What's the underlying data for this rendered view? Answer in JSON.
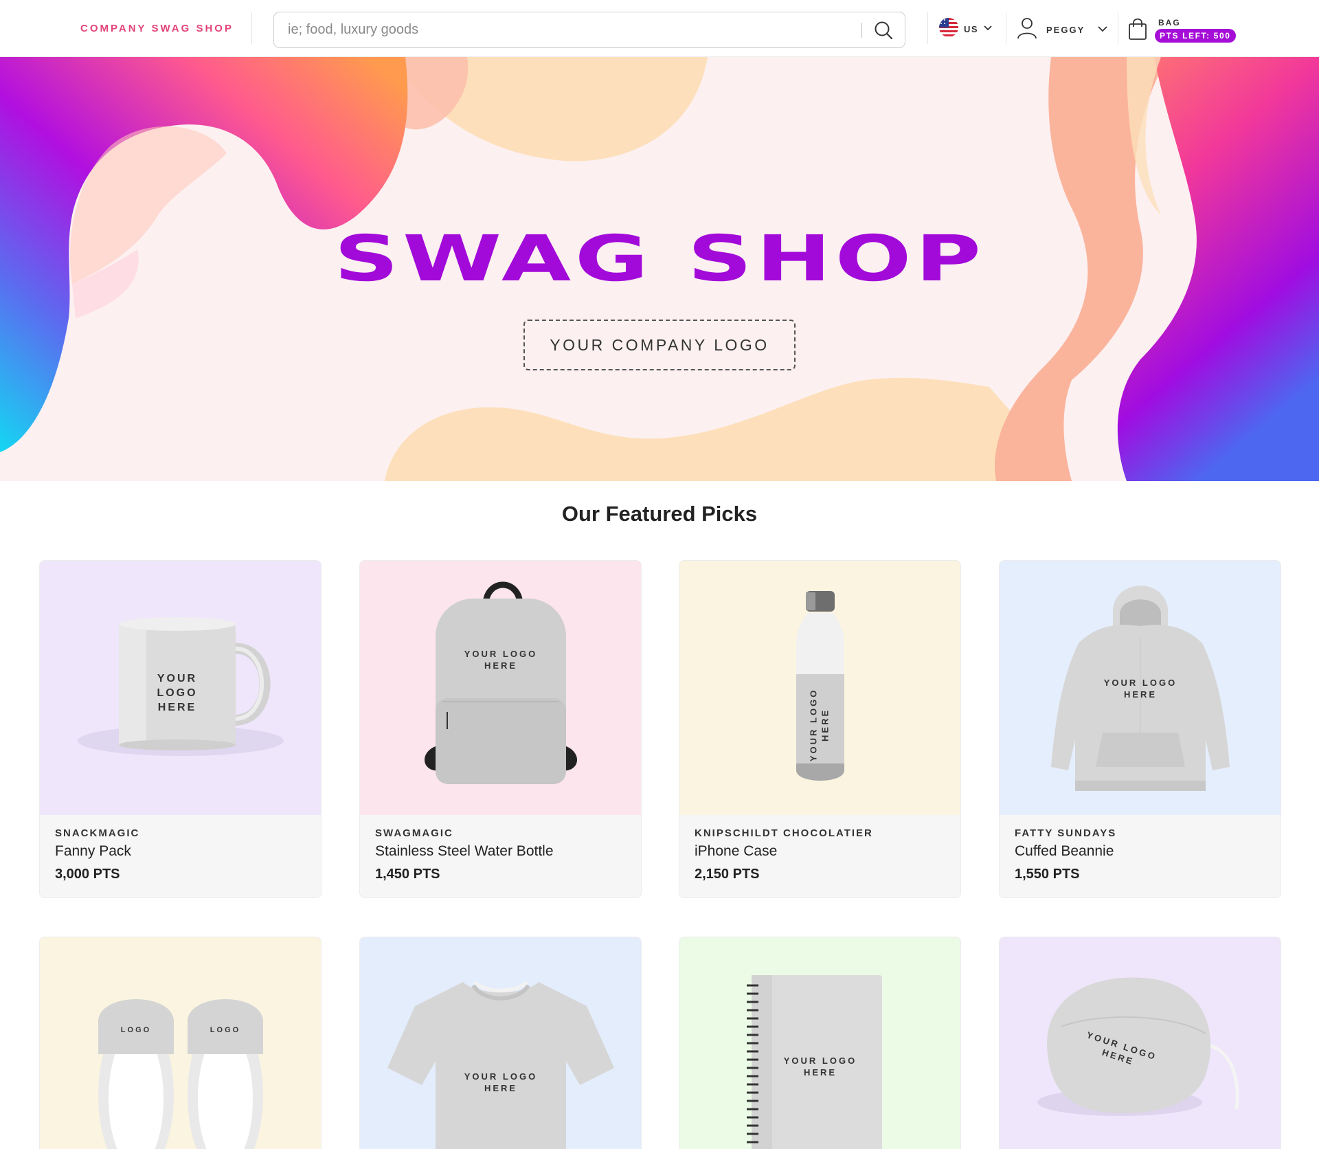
{
  "header": {
    "brand": "COMPANY SWAG SHOP",
    "search_placeholder": "ie; food, luxury goods",
    "locale": "US",
    "user_name": "PEGGY",
    "bag_label": "BAG",
    "points_badge": "PTS LEFT: 500"
  },
  "hero": {
    "title": "SWAG SHOP",
    "logo_placeholder": "YOUR COMPANY LOGO"
  },
  "featured": {
    "title": "Our Featured Picks",
    "products": [
      {
        "vendor": "SNACKMAGIC",
        "name": "Fanny Pack",
        "price": "3,000 PTS",
        "image": "mug",
        "image_text": "YOUR LOGO HERE",
        "bg": "#efe6fb"
      },
      {
        "vendor": "SWAGMAGIC",
        "name": "Stainless Steel Water Bottle",
        "price": "1,450 PTS",
        "image": "backpack",
        "image_text": "YOUR LOGO HERE",
        "bg": "#fce5ec"
      },
      {
        "vendor": "KNIPSCHILDT CHOCOLATIER",
        "name": "iPhone Case",
        "price": "2,150 PTS",
        "image": "water-bottle",
        "image_text": "YOUR LOGO HERE",
        "bg": "#fbf4e1"
      },
      {
        "vendor": "FATTY SUNDAYS",
        "name": "Cuffed Beannie",
        "price": "1,550 PTS",
        "image": "hoodie",
        "image_text": "YOUR LOGO HERE",
        "bg": "#e5eefc"
      }
    ],
    "more_products": [
      {
        "image": "slides",
        "image_text": "LOGO",
        "bg": "#fbf4e1"
      },
      {
        "image": "t-shirt",
        "image_text": "YOUR LOGO HERE",
        "bg": "#e3edfc"
      },
      {
        "image": "notebook",
        "image_text": "YOUR LOGO HERE",
        "bg": "#ebfbe6"
      },
      {
        "image": "face-mask",
        "image_text": "YOUR LOGO HERE",
        "bg": "#efe6fb"
      }
    ]
  },
  "colors": {
    "brand_pink": "#e2447a",
    "accent_purple": "#a20ad9",
    "badge_purple": "#a40ed6"
  }
}
